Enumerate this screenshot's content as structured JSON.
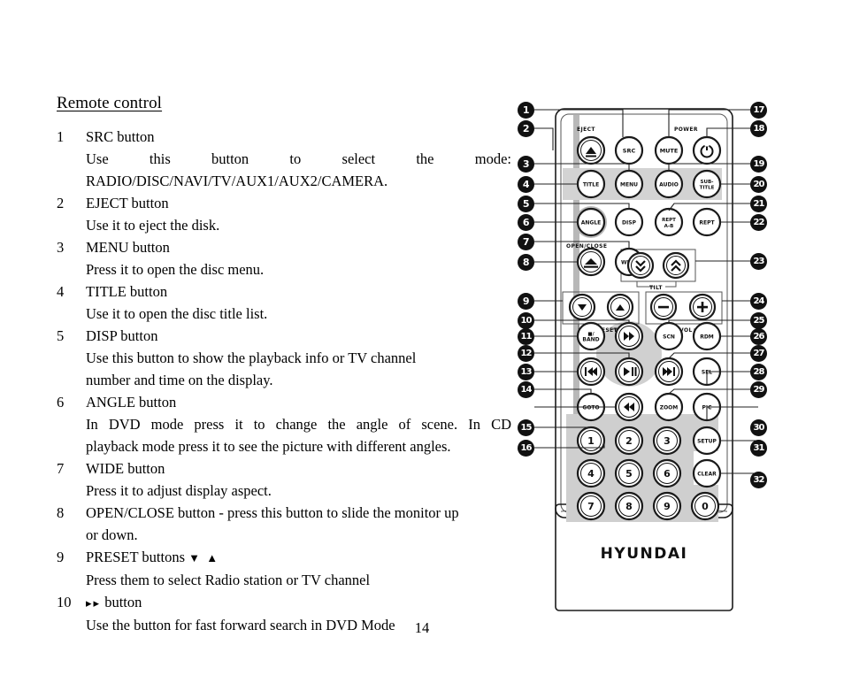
{
  "document": {
    "title": "Remote control",
    "page_number": "14",
    "entries": [
      {
        "num": "1",
        "label": "SRC button",
        "desc": "Use this button to select the mode: RADIO/DISC/NAVI/TV/AUX1/AUX2/CAMERA.",
        "desc_line1": "Use this button to select the mode:",
        "desc_line2": "RADIO/DISC/NAVI/TV/AUX1/AUX2/CAMERA.",
        "justify1": true
      },
      {
        "num": "2",
        "label": "EJECT button",
        "desc": "Use it to eject the disk."
      },
      {
        "num": "3",
        "label": "MENU button",
        "desc": "Press it to open the disc menu."
      },
      {
        "num": "4",
        "label": "TITLE button",
        "desc": "Use it to open the disc title list."
      },
      {
        "num": "5",
        "label": "DISP button",
        "desc_line1": "Use this button to show the playback info or TV channel",
        "desc_line2": "number and time on the display."
      },
      {
        "num": "6",
        "label": "ANGLE button",
        "desc_line1": "In DVD mode press it to change the angle of scene. In CD",
        "desc_line2": "playback mode press it to see the picture with different angles.",
        "justify1": true
      },
      {
        "num": "7",
        "label": "WIDE button",
        "desc": "Press it to adjust display aspect."
      },
      {
        "num": "8",
        "label": "OPEN/CLOSE button - press this button to slide the monitor up",
        "desc": "or down.",
        "label_wrap": true
      },
      {
        "num": "9",
        "label": "PRESET buttons",
        "label_symbols": "▼ ▲",
        "desc": "Press them to select Radio station or TV channel"
      },
      {
        "num": "10",
        "label_symbols": "▸▸",
        "label": "button",
        "desc": "Use the button for fast forward search in DVD Mode"
      }
    ]
  },
  "figure": {
    "brand": "HYUNDAI",
    "group_labels": {
      "eject": "EJECT",
      "power": "POWER",
      "open_close": "OPEN/CLOSE",
      "tilt": "TILT",
      "preset": "PRESET",
      "vol": "VOL"
    },
    "buttons": [
      {
        "id": "eject",
        "label": "⏏",
        "row": 1
      },
      {
        "id": "src",
        "label": "SRC",
        "row": 1
      },
      {
        "id": "mute",
        "label": "MUTE",
        "row": 1
      },
      {
        "id": "power",
        "label": "⏻",
        "row": 1
      },
      {
        "id": "title",
        "label": "TITLE",
        "row": 2
      },
      {
        "id": "menu",
        "label": "MENU",
        "row": 2
      },
      {
        "id": "audio",
        "label": "AUDIO",
        "row": 2
      },
      {
        "id": "subtitle",
        "label": "SUB-TITLE",
        "row": 2
      },
      {
        "id": "angle",
        "label": "ANGLE",
        "row": 3
      },
      {
        "id": "disp",
        "label": "DISP",
        "row": 3
      },
      {
        "id": "rept_ab",
        "label": "REPT A-B",
        "row": 3
      },
      {
        "id": "rept",
        "label": "REPT",
        "row": 3
      },
      {
        "id": "openclose",
        "label": "⏏",
        "row": 4
      },
      {
        "id": "wide",
        "label": "WIDE",
        "row": 4
      },
      {
        "id": "tilt_down",
        "label": "⌄⌄",
        "row": 4
      },
      {
        "id": "tilt_up",
        "label": "⌃⌃",
        "row": 4
      },
      {
        "id": "preset_down",
        "label": "▼",
        "row": 5
      },
      {
        "id": "preset_up",
        "label": "▲",
        "row": 5
      },
      {
        "id": "vol_down",
        "label": "−",
        "row": 5
      },
      {
        "id": "vol_up",
        "label": "+",
        "row": 5
      },
      {
        "id": "band",
        "label": "■/BAND",
        "row": 6
      },
      {
        "id": "ff_fast",
        "label": "▶▶",
        "row": 6
      },
      {
        "id": "scn",
        "label": "SCN",
        "row": 6
      },
      {
        "id": "rdm",
        "label": "RDM",
        "row": 6
      },
      {
        "id": "prev",
        "label": "|◀◀",
        "row": 7
      },
      {
        "id": "play",
        "label": "▶/II",
        "row": 7
      },
      {
        "id": "next",
        "label": "▶▶|",
        "row": 7
      },
      {
        "id": "sel",
        "label": "SEL",
        "row": 7
      },
      {
        "id": "goto",
        "label": "GOTO",
        "row": 8
      },
      {
        "id": "rew",
        "label": "◀◀",
        "row": 8
      },
      {
        "id": "zoom",
        "label": "ZOOM",
        "row": 8
      },
      {
        "id": "pic",
        "label": "PIC",
        "row": 8
      },
      {
        "id": "num1",
        "label": "1",
        "row": 9
      },
      {
        "id": "num2",
        "label": "2",
        "row": 9
      },
      {
        "id": "num3",
        "label": "3",
        "row": 9
      },
      {
        "id": "setup",
        "label": "SETUP",
        "row": 9
      },
      {
        "id": "num4",
        "label": "4",
        "row": 10
      },
      {
        "id": "num5",
        "label": "5",
        "row": 10
      },
      {
        "id": "num6",
        "label": "6",
        "row": 10
      },
      {
        "id": "clear",
        "label": "CLEAR",
        "row": 10
      },
      {
        "id": "num7",
        "label": "7",
        "row": 11
      },
      {
        "id": "num8",
        "label": "8",
        "row": 11
      },
      {
        "id": "num9",
        "label": "9",
        "row": 11
      },
      {
        "id": "num0",
        "label": "0",
        "row": 11
      }
    ],
    "callouts_left": [
      "1",
      "2",
      "3",
      "4",
      "5",
      "6",
      "7",
      "8",
      "9",
      "10",
      "11",
      "12",
      "13",
      "14",
      "15",
      "16"
    ],
    "callouts_right": [
      "17",
      "18",
      "19",
      "20",
      "21",
      "22",
      "23",
      "24",
      "25",
      "26",
      "27",
      "28",
      "29",
      "30",
      "31",
      "32"
    ]
  }
}
